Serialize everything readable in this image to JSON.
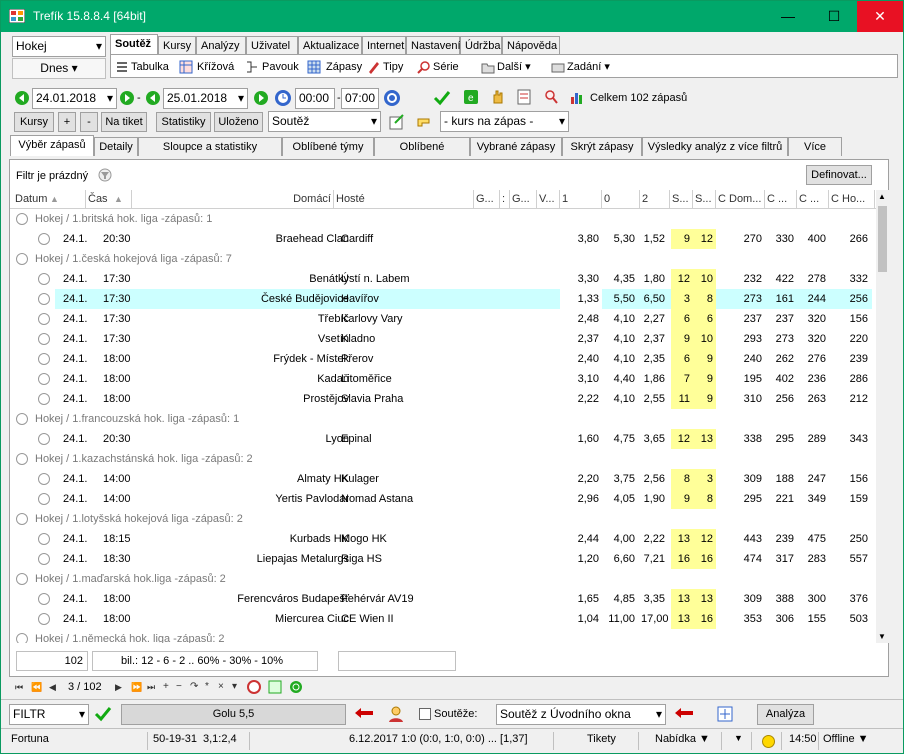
{
  "window": {
    "title": "Trefík 15.8.8.4 [64bit]",
    "min": "—",
    "max": "☐",
    "close": "✕"
  },
  "sport_select": "Hokej",
  "day_select": "Dnes",
  "menu_tabs": [
    "Soutěž",
    "Kursy",
    "Analýzy",
    "Uživatel",
    "Aktualizace",
    "Internet",
    "Nastavení",
    "Údržba",
    "Nápověda"
  ],
  "toolbar": {
    "tabulka": "Tabulka",
    "krizova": "Křížová",
    "pavouk": "Pavouk",
    "zapasy": "Zápasy",
    "tipy": "Tipy",
    "serie": "Série",
    "dalsi": "Další",
    "zadani": "Zadání"
  },
  "dates": {
    "from": "24.01.2018",
    "to": "25.01.2018",
    "time_from": "00:00",
    "time_to": "07:00",
    "dash": "-",
    "total": "Celkem 102 zápasů"
  },
  "buttons": {
    "kursy": "Kursy",
    "plus": "+",
    "minus": "-",
    "na_tiket": "Na tiket",
    "statistiky": "Statistiky",
    "ulozeno": "Uloženo",
    "soutez": "Soutěž",
    "kurs_na_zapas": "- kurs na zápas -"
  },
  "view_tabs": [
    "Výběr zápasů",
    "Detaily",
    "Sloupce a statistiky",
    "Oblíbené týmy",
    "Oblíbené soutěže",
    "Vybrané zápasy",
    "Skrýt zápasy",
    "Výsledky analýz z více filtrů",
    "Více filtrů"
  ],
  "filter": {
    "label": "Filtr je prázdný",
    "define": "Definovat..."
  },
  "columns": [
    "Datum",
    "Čas",
    "Domácí",
    "Hosté",
    "G...",
    ":",
    "G...",
    "V...",
    "1",
    "0",
    "2",
    "S...",
    "S...",
    "C Dom...",
    "C ...",
    "C ...",
    "C Ho..."
  ],
  "groups": [
    {
      "title": "Hokej / 1.britská hok. liga -zápasů: 1",
      "rows": [
        [
          "24.1.",
          "20:30",
          "Braehead Clan",
          "Cardiff",
          "3,80",
          "5,30",
          "1,52",
          "9",
          "12",
          "270",
          "330",
          "400",
          "266"
        ]
      ]
    },
    {
      "title": "Hokej / 1.česká hokejová liga -zápasů: 7",
      "rows": [
        [
          "24.1.",
          "17:30",
          "Benátky",
          "Ústí n. Labem",
          "3,30",
          "4,35",
          "1,80",
          "12",
          "10",
          "232",
          "422",
          "278",
          "332"
        ],
        [
          "24.1.",
          "17:30",
          "České Budějovice",
          "Havířov",
          "1,33",
          "5,50",
          "6,50",
          "3",
          "8",
          "273",
          "161",
          "244",
          "256"
        ],
        [
          "24.1.",
          "17:30",
          "Třebíč",
          "Karlovy Vary",
          "2,48",
          "4,10",
          "2,27",
          "6",
          "6",
          "237",
          "237",
          "320",
          "156"
        ],
        [
          "24.1.",
          "17:30",
          "Vsetín",
          "Kladno",
          "2,37",
          "4,10",
          "2,37",
          "9",
          "10",
          "293",
          "273",
          "320",
          "220"
        ],
        [
          "24.1.",
          "18:00",
          "Frýdek - Místek",
          "Přerov",
          "2,40",
          "4,10",
          "2,35",
          "6",
          "9",
          "240",
          "262",
          "276",
          "239"
        ],
        [
          "24.1.",
          "18:00",
          "Kadaň",
          "Litoměřice",
          "3,10",
          "4,40",
          "1,86",
          "7",
          "9",
          "195",
          "402",
          "236",
          "286"
        ],
        [
          "24.1.",
          "18:00",
          "Prostějov",
          "Slavia Praha",
          "2,22",
          "4,10",
          "2,55",
          "11",
          "9",
          "310",
          "256",
          "263",
          "212"
        ]
      ]
    },
    {
      "title": "Hokej / 1.francouzská hok. liga -zápasů: 1",
      "rows": [
        [
          "24.1.",
          "20:30",
          "Lyon",
          "Epinal",
          "1,60",
          "4,75",
          "3,65",
          "12",
          "13",
          "338",
          "295",
          "289",
          "343"
        ]
      ]
    },
    {
      "title": "Hokej / 1.kazachstánská hok. liga -zápasů: 2",
      "rows": [
        [
          "24.1.",
          "14:00",
          "Almaty HK",
          "Kulager",
          "2,20",
          "3,75",
          "2,56",
          "8",
          "3",
          "309",
          "188",
          "247",
          "156"
        ],
        [
          "24.1.",
          "14:00",
          "Yertis Pavlodar",
          "Nomad Astana",
          "2,96",
          "4,05",
          "1,90",
          "9",
          "8",
          "295",
          "221",
          "349",
          "159"
        ]
      ]
    },
    {
      "title": "Hokej / 1.lotyšská hokejová liga -zápasů: 2",
      "rows": [
        [
          "24.1.",
          "18:15",
          "Kurbads HK",
          "Mogo HK",
          "2,44",
          "4,00",
          "2,22",
          "13",
          "12",
          "443",
          "239",
          "475",
          "250"
        ],
        [
          "24.1.",
          "18:30",
          "Liepajas Metalurgs",
          "Riga HS",
          "1,20",
          "6,60",
          "7,21",
          "16",
          "16",
          "474",
          "317",
          "283",
          "557"
        ]
      ]
    },
    {
      "title": "Hokej / 1.maďarská hok.liga -zápasů: 2",
      "rows": [
        [
          "24.1.",
          "18:00",
          "Ferencváros Budapešť",
          "Fehérvár AV19",
          "1,65",
          "4,85",
          "3,35",
          "13",
          "13",
          "309",
          "388",
          "300",
          "376"
        ],
        [
          "24.1.",
          "18:00",
          "Miercurea Ciuc",
          "CE Wien II",
          "1,04",
          "11,00",
          "17,00",
          "13",
          "16",
          "353",
          "306",
          "155",
          "503"
        ]
      ]
    },
    {
      "title": "Hokej / 1.německá hok. liga -zápasů: 2",
      "rows": []
    }
  ],
  "footer": {
    "count": "102",
    "stats": "bil.: 12 - 6 - 2 .. 60% - 30% - 10%",
    "nav": "3 / 102"
  },
  "bottom": {
    "filtr": "FILTR",
    "golu": "Golu 5,5",
    "souteze": "Soutěže:",
    "soutez_select": "Soutěž z Úvodního okna",
    "analyza": "Analýza"
  },
  "status": {
    "bookmaker": "Fortuna",
    "score1": "50-19-31",
    "score2": "3,1:2,4",
    "match": "6.12.2017 1:0 (0:0, 1:0, 0:0) ... [1,37]",
    "tikety": "Tikety",
    "nabidka": "Nabídka ▼",
    "time": "14:50",
    "offline": "Offline ▼"
  },
  "colors": {
    "title_bg": "#00a86b",
    "selected_row": "#ccffff",
    "highlight": "#ffff99"
  }
}
